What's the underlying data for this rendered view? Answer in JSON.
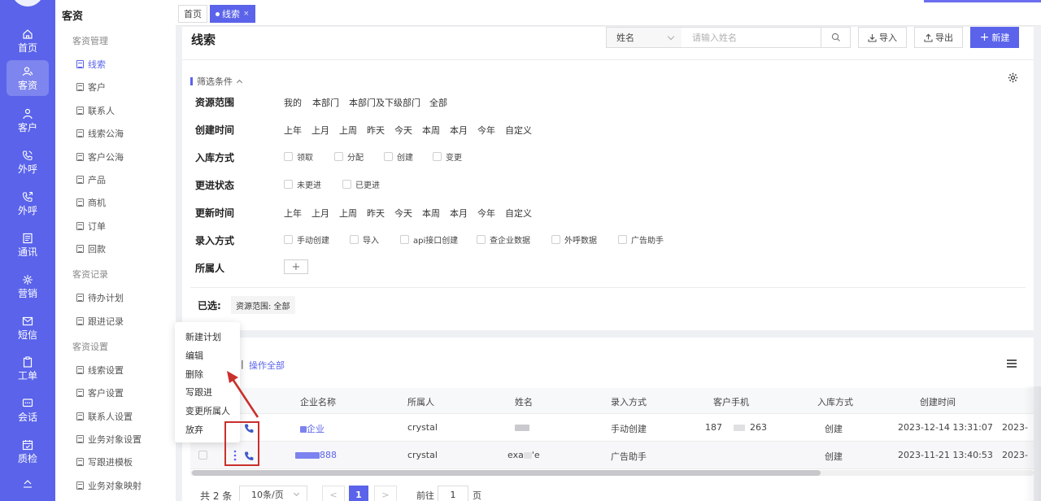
{
  "rail": {
    "items": [
      {
        "label": "首页",
        "icon": "home-icon"
      },
      {
        "label": "客资",
        "icon": "users-icon",
        "active": true
      },
      {
        "label": "客户",
        "icon": "user-icon"
      },
      {
        "label": "外呼",
        "icon": "phone-call-icon"
      },
      {
        "label": "外呼",
        "icon": "phone-out-icon"
      },
      {
        "label": "通讯",
        "icon": "contacts-icon"
      },
      {
        "label": "营销",
        "icon": "marketing-icon"
      },
      {
        "label": "短信",
        "icon": "sms-icon"
      },
      {
        "label": "工单",
        "icon": "clipboard-icon"
      },
      {
        "label": "会话",
        "icon": "chat-icon"
      },
      {
        "label": "质检",
        "icon": "calendar-check-icon"
      }
    ]
  },
  "submenu": {
    "title": "客资",
    "groups": [
      {
        "label": "客资管理"
      },
      {
        "label": "客资记录"
      },
      {
        "label": "客资设置"
      }
    ],
    "items": [
      {
        "label": "线索",
        "active": true
      },
      {
        "label": "客户"
      },
      {
        "label": "联系人"
      },
      {
        "label": "线索公海"
      },
      {
        "label": "客户公海"
      },
      {
        "label": "产品"
      },
      {
        "label": "商机"
      },
      {
        "label": "订单"
      },
      {
        "label": "回款"
      },
      {
        "label": "待办计划"
      },
      {
        "label": "跟进记录"
      },
      {
        "label": "线索设置"
      },
      {
        "label": "客户设置"
      },
      {
        "label": "联系人设置"
      },
      {
        "label": "业务对象设置"
      },
      {
        "label": "写跟进模板"
      },
      {
        "label": "业务对象映射"
      }
    ]
  },
  "tabs": [
    {
      "label": "首页"
    },
    {
      "label": "线索",
      "close": "×",
      "active": true
    }
  ],
  "header": {
    "title": "线索",
    "search_field": "姓名",
    "search_placeholder": "请输入姓名",
    "import_label": "导入",
    "export_label": "导出",
    "new_label": "新建",
    "new_prefix": "+"
  },
  "filters": {
    "toggle_label": "筛选条件",
    "rows": [
      {
        "label": "资源范围",
        "options": [
          "我的",
          "本部门",
          "本部门及下级部门",
          "全部"
        ]
      },
      {
        "label": "创建时间",
        "options": [
          "上年",
          "上月",
          "上周",
          "昨天",
          "今天",
          "本周",
          "本月",
          "今年",
          "自定义"
        ]
      },
      {
        "label": "入库方式",
        "checkboxes": [
          "领取",
          "分配",
          "创建",
          "变更"
        ]
      },
      {
        "label": "更进状态",
        "checkboxes": [
          "未更进",
          "已更进"
        ]
      },
      {
        "label": "更新时间",
        "options": [
          "上年",
          "上月",
          "上周",
          "昨天",
          "今天",
          "本周",
          "本月",
          "今年",
          "自定义"
        ]
      },
      {
        "label": "录入方式",
        "checkboxes": [
          "手动创建",
          "导入",
          "api接口创建",
          "查企业数据",
          "外呼数据",
          "广告助手"
        ]
      },
      {
        "label": "所属人",
        "add": "+"
      }
    ],
    "selected_label": "已选:",
    "selected_tag": "资源范围: 全部"
  },
  "table": {
    "op_sep": "|",
    "op_all": "操作全部",
    "columns": [
      "企业名称",
      "所属人",
      "姓名",
      "录入方式",
      "客户手机",
      "入库方式",
      "创建时间"
    ],
    "rows": [
      {
        "company": "企业",
        "owner": "crystal",
        "name": "",
        "entry": "手动创建",
        "phone_prefix": "187",
        "phone_suffix": "263",
        "storage": "创建",
        "created": "2023-12-14 13:31:07",
        "extra": "2023-"
      },
      {
        "company": "888",
        "owner": "crystal",
        "name_prefix": "exa",
        "name_suffix": "'e",
        "entry": "广告助手",
        "storage": "创建",
        "created": "2023-11-21 13:40:53",
        "extra": "2023-"
      }
    ]
  },
  "pager": {
    "total": "共 2 条",
    "page_size": "10条/页",
    "current": "1",
    "goto_label": "前往",
    "goto_value": "1",
    "page_suffix": "页",
    "prev": "<",
    "next": ">"
  },
  "context_menu": {
    "items": [
      "新建计划",
      "编辑",
      "删除",
      "写跟进",
      "变更所属人",
      "放弃"
    ]
  },
  "colors": {
    "brand": "#5a63ea",
    "highlight": "#c9302c"
  }
}
